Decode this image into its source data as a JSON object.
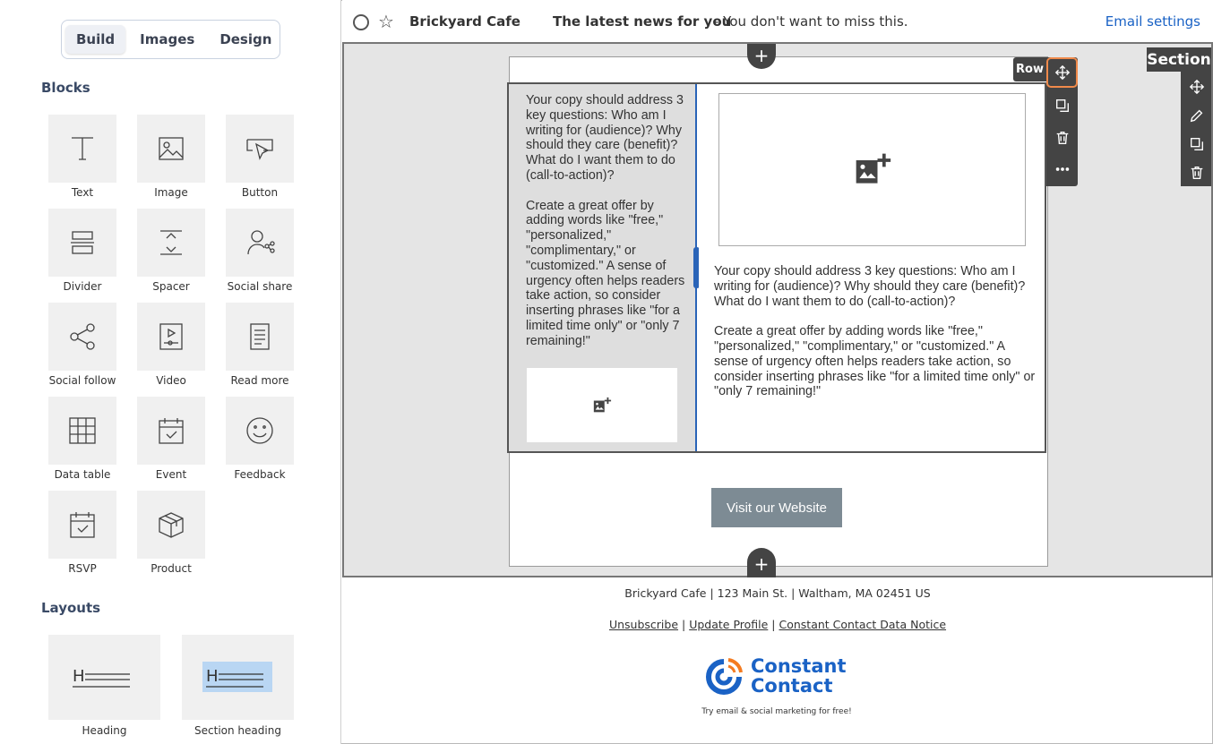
{
  "left_panel": {
    "tabs": [
      "Build",
      "Images",
      "Design"
    ],
    "blocks_heading": "Blocks",
    "blocks": [
      "Text",
      "Image",
      "Button",
      "Divider",
      "Spacer",
      "Social share",
      "Social follow",
      "Video",
      "Read more",
      "Data table",
      "Event",
      "Feedback",
      "RSVP",
      "Product"
    ],
    "layouts_heading": "Layouts",
    "layouts": [
      "Heading",
      "Section heading"
    ]
  },
  "header": {
    "from": "Brickyard Cafe",
    "subject": "The latest news for you",
    "preheader": " - You don't want to miss this.",
    "email_settings": "Email settings"
  },
  "editor": {
    "row_label": "Row",
    "section_label": "Section",
    "left_copy": "Your copy should address 3 key questions: Who am I writing for (audience)? Why should they care (benefit)? What do I want them to do (call-to-action)?\n\nCreate a great offer by adding words like \"free,\" \"personalized,\" \"complimentary,\" or \"customized.\" A sense of urgency often helps readers take action, so consider inserting phrases like \"for a limited time only\" or \"only 7 remaining!\"",
    "right_copy": "Your copy should address 3 key questions: Who am I writing for (audience)? Why should they care (benefit)? What do I want them to do (call-to-action)?\n\nCreate a great offer by adding words like \"free,\" \"personalized,\" \"complimentary,\" or \"customized.\" A sense of urgency often helps readers take action, so consider inserting phrases like \"for a limited time only\" or \"only 7 remaining!\"",
    "cta_label": "Visit our Website"
  },
  "footer": {
    "address": "Brickyard Cafe | 123 Main St. | Waltham, MA 02451 US",
    "links": [
      "Unsubscribe",
      "Update Profile",
      "Constant Contact Data Notice"
    ],
    "brand_line1": "Constant",
    "brand_line2": "Contact",
    "tagline": "Try email & social marketing for free!"
  },
  "colors": {
    "accent_blue": "#1a62c5",
    "selected_outline": "#f08a4b",
    "toolbar": "#444444"
  }
}
